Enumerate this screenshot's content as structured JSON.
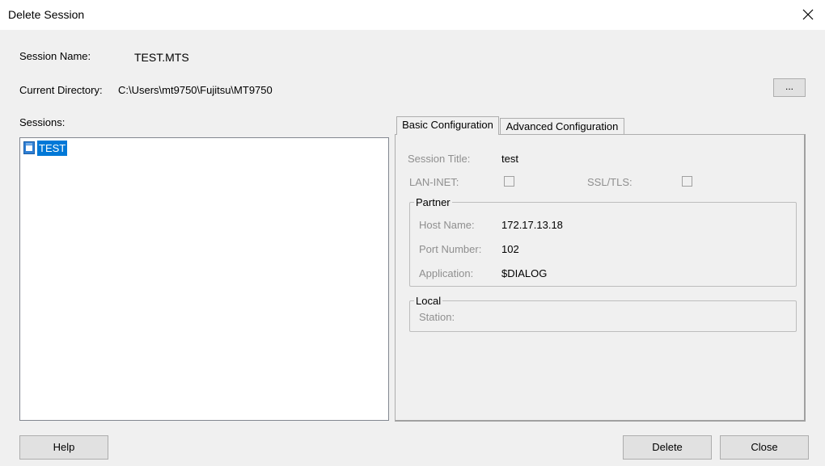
{
  "window": {
    "title": "Delete Session",
    "close_icon": "close-icon"
  },
  "form": {
    "session_name_label": "Session Name:",
    "session_name_value": "TEST.MTS",
    "current_directory_label": "Current Directory:",
    "current_directory_value": "C:\\Users\\mt9750\\Fujitsu\\MT9750",
    "browse_label": "...",
    "sessions_label": "Sessions:"
  },
  "sessions": {
    "items": [
      {
        "label": "TEST",
        "icon": "session-file-icon",
        "selected": true
      }
    ]
  },
  "tabs": [
    {
      "label": "Basic Configuration",
      "active": true
    },
    {
      "label": "Advanced Configuration",
      "active": false
    }
  ],
  "basic": {
    "session_title_label": "Session Title:",
    "session_title_value": "test",
    "lan_inet_label": "LAN-INET:",
    "lan_inet_checked": false,
    "ssl_tls_label": "SSL/TLS:",
    "ssl_tls_checked": false,
    "partner": {
      "legend": "Partner",
      "host_name_label": "Host Name:",
      "host_name_value": "172.17.13.18",
      "port_number_label": "Port Number:",
      "port_number_value": "102",
      "application_label": "Application:",
      "application_value": "$DIALOG"
    },
    "local": {
      "legend": "Local",
      "station_label": "Station:",
      "station_value": ""
    }
  },
  "buttons": {
    "help": "Help",
    "delete": "Delete",
    "close": "Close"
  },
  "colors": {
    "selection": "#0078d7",
    "background": "#f0f0f0"
  }
}
